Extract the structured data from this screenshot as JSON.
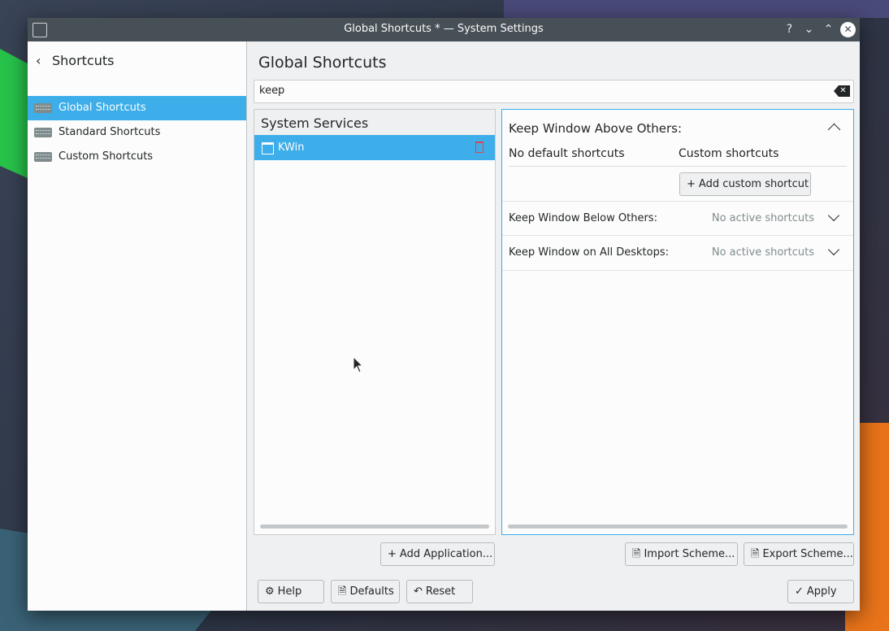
{
  "window": {
    "title": "Global Shortcuts * — System Settings",
    "buttons": {
      "help": "?",
      "minimize": "⌄",
      "maximize": "⌃",
      "close": "✕"
    }
  },
  "sidebar": {
    "back_label": "Shortcuts",
    "items": [
      {
        "label": "Global Shortcuts",
        "active": true
      },
      {
        "label": "Standard Shortcuts",
        "active": false
      },
      {
        "label": "Custom Shortcuts",
        "active": false
      }
    ]
  },
  "main": {
    "title": "Global Shortcuts",
    "search_value": "keep",
    "services": {
      "header": "System Services",
      "selected": "KWin"
    },
    "shortcuts": {
      "expanded": {
        "title": "Keep Window Above Others:",
        "default_label": "No default shortcuts",
        "custom_label": "Custom shortcuts",
        "add_button": "Add custom shortcut"
      },
      "rows": [
        {
          "name": "Keep Window Below Others:",
          "status": "No active shortcuts"
        },
        {
          "name": "Keep Window on All Desktops:",
          "status": "No active shortcuts"
        }
      ]
    },
    "buttons": {
      "add_application": "Add Application...",
      "import_scheme": "Import Scheme...",
      "export_scheme": "Export Scheme...",
      "help": "Help",
      "defaults": "Defaults",
      "reset": "Reset",
      "apply": "Apply"
    }
  },
  "colors": {
    "accent": "#3daee9",
    "titlebar": "#475057",
    "delete": "#da4453"
  }
}
